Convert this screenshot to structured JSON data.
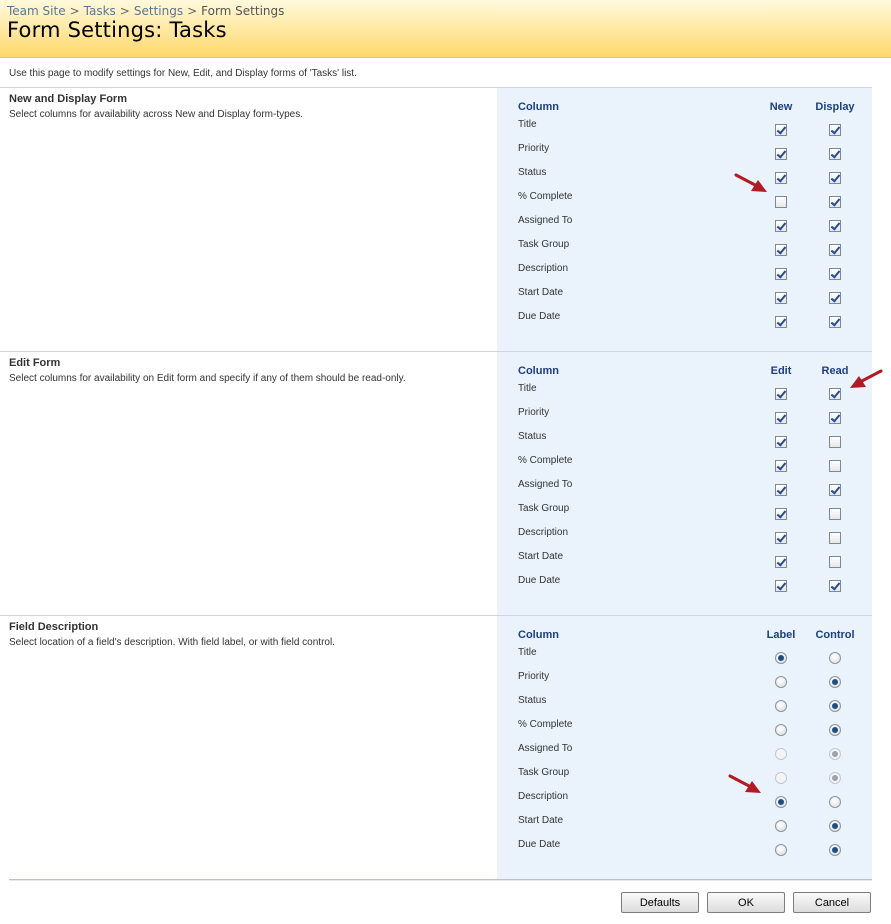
{
  "breadcrumb": [
    {
      "label": "Team Site",
      "link": true
    },
    {
      "label": "Tasks",
      "link": true
    },
    {
      "label": "Settings",
      "link": true
    },
    {
      "label": "Form Settings",
      "link": false
    }
  ],
  "breadcrumb_separator": ">",
  "page_title": "Form Settings: Tasks",
  "intro": "Use this page to modify settings for New, Edit, and Display forms of 'Tasks' list.",
  "sections": [
    {
      "id": "new-display",
      "title": "New and Display Form",
      "description": "Select columns for availability across New and Display form-types.",
      "control": "checkbox",
      "headers": {
        "column": "Column",
        "c1": "New",
        "c2": "Display"
      },
      "rows": [
        {
          "label": "Title",
          "c1": true,
          "c2": true
        },
        {
          "label": "Priority",
          "c1": true,
          "c2": true
        },
        {
          "label": "Status",
          "c1": true,
          "c2": true
        },
        {
          "label": "% Complete",
          "c1": false,
          "c2": true
        },
        {
          "label": "Assigned To",
          "c1": true,
          "c2": true
        },
        {
          "label": "Task Group",
          "c1": true,
          "c2": true
        },
        {
          "label": "Description",
          "c1": true,
          "c2": true
        },
        {
          "label": "Start Date",
          "c1": true,
          "c2": true
        },
        {
          "label": "Due Date",
          "c1": true,
          "c2": true
        }
      ]
    },
    {
      "id": "edit",
      "title": "Edit Form",
      "description": "Select columns for availability on Edit form and specify if any of them should be read-only.",
      "control": "checkbox",
      "headers": {
        "column": "Column",
        "c1": "Edit",
        "c2": "Read"
      },
      "rows": [
        {
          "label": "Title",
          "c1": true,
          "c2": true
        },
        {
          "label": "Priority",
          "c1": true,
          "c2": true
        },
        {
          "label": "Status",
          "c1": true,
          "c2": false
        },
        {
          "label": "% Complete",
          "c1": true,
          "c2": false
        },
        {
          "label": "Assigned To",
          "c1": true,
          "c2": true
        },
        {
          "label": "Task Group",
          "c1": true,
          "c2": false
        },
        {
          "label": "Description",
          "c1": true,
          "c2": false
        },
        {
          "label": "Start Date",
          "c1": true,
          "c2": false
        },
        {
          "label": "Due Date",
          "c1": true,
          "c2": true
        }
      ]
    },
    {
      "id": "field-description",
      "title": "Field Description",
      "description": "Select location of a field's description. With field label, or with field control.",
      "control": "radio",
      "headers": {
        "column": "Column",
        "c1": "Label",
        "c2": "Control"
      },
      "rows": [
        {
          "label": "Title",
          "selected": "c1",
          "disabled": false
        },
        {
          "label": "Priority",
          "selected": "c2",
          "disabled": false
        },
        {
          "label": "Status",
          "selected": "c2",
          "disabled": false
        },
        {
          "label": "% Complete",
          "selected": "c2",
          "disabled": false
        },
        {
          "label": "Assigned To",
          "selected": "c2",
          "disabled": true
        },
        {
          "label": "Task Group",
          "selected": "c2",
          "disabled": true
        },
        {
          "label": "Description",
          "selected": "c1",
          "disabled": false
        },
        {
          "label": "Start Date",
          "selected": "c2",
          "disabled": false
        },
        {
          "label": "Due Date",
          "selected": "c2",
          "disabled": false
        }
      ]
    }
  ],
  "buttons": {
    "defaults": "Defaults",
    "ok": "OK",
    "cancel": "Cancel"
  },
  "colors": {
    "title_band": "#ffe79e",
    "panel": "#eaf2fc",
    "header_text": "#1c3f82",
    "breadcrumb_link": "#5a7796",
    "arrow": "#b01c24"
  },
  "icons": {
    "annotation": "red-arrow-icon",
    "check": "checkmark-icon"
  }
}
